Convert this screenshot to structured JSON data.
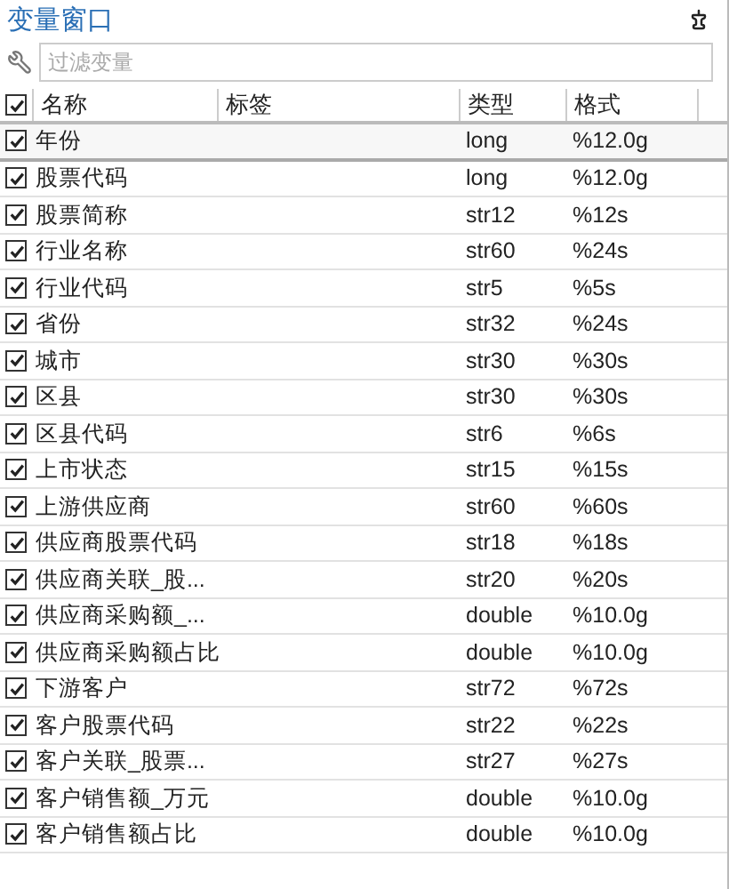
{
  "window": {
    "title": "变量窗口"
  },
  "filter": {
    "placeholder": "过滤变量"
  },
  "table": {
    "all_checked": true,
    "columns": [
      "名称",
      "标签",
      "类型",
      "格式"
    ],
    "rows": [
      {
        "name": "年份",
        "type": "long",
        "format": "%12.0g",
        "checked": true,
        "selected": true
      },
      {
        "name": "股票代码",
        "type": "long",
        "format": "%12.0g",
        "checked": true,
        "selected": false
      },
      {
        "name": "股票简称",
        "type": "str12",
        "format": "%12s",
        "checked": true,
        "selected": false
      },
      {
        "name": "行业名称",
        "type": "str60",
        "format": "%24s",
        "checked": true,
        "selected": false
      },
      {
        "name": "行业代码",
        "type": "str5",
        "format": "%5s",
        "checked": true,
        "selected": false
      },
      {
        "name": "省份",
        "type": "str32",
        "format": "%24s",
        "checked": true,
        "selected": false
      },
      {
        "name": "城市",
        "type": "str30",
        "format": "%30s",
        "checked": true,
        "selected": false
      },
      {
        "name": "区县",
        "type": "str30",
        "format": "%30s",
        "checked": true,
        "selected": false
      },
      {
        "name": "区县代码",
        "type": "str6",
        "format": "%6s",
        "checked": true,
        "selected": false
      },
      {
        "name": "上市状态",
        "type": "str15",
        "format": "%15s",
        "checked": true,
        "selected": false
      },
      {
        "name": "上游供应商",
        "type": "str60",
        "format": "%60s",
        "checked": true,
        "selected": false
      },
      {
        "name": "供应商股票代码",
        "type": "str18",
        "format": "%18s",
        "checked": true,
        "selected": false
      },
      {
        "name": "供应商关联_股...",
        "type": "str20",
        "format": "%20s",
        "checked": true,
        "selected": false
      },
      {
        "name": "供应商采购额_...",
        "type": "double",
        "format": "%10.0g",
        "checked": true,
        "selected": false
      },
      {
        "name": "供应商采购额占比",
        "type": "double",
        "format": "%10.0g",
        "checked": true,
        "selected": false
      },
      {
        "name": "下游客户",
        "type": "str72",
        "format": "%72s",
        "checked": true,
        "selected": false
      },
      {
        "name": "客户股票代码",
        "type": "str22",
        "format": "%22s",
        "checked": true,
        "selected": false
      },
      {
        "name": "客户关联_股票...",
        "type": "str27",
        "format": "%27s",
        "checked": true,
        "selected": false
      },
      {
        "name": "客户销售额_万元",
        "type": "double",
        "format": "%10.0g",
        "checked": true,
        "selected": false
      },
      {
        "name": "客户销售额占比",
        "type": "double",
        "format": "%10.0g",
        "checked": true,
        "selected": false
      }
    ]
  }
}
